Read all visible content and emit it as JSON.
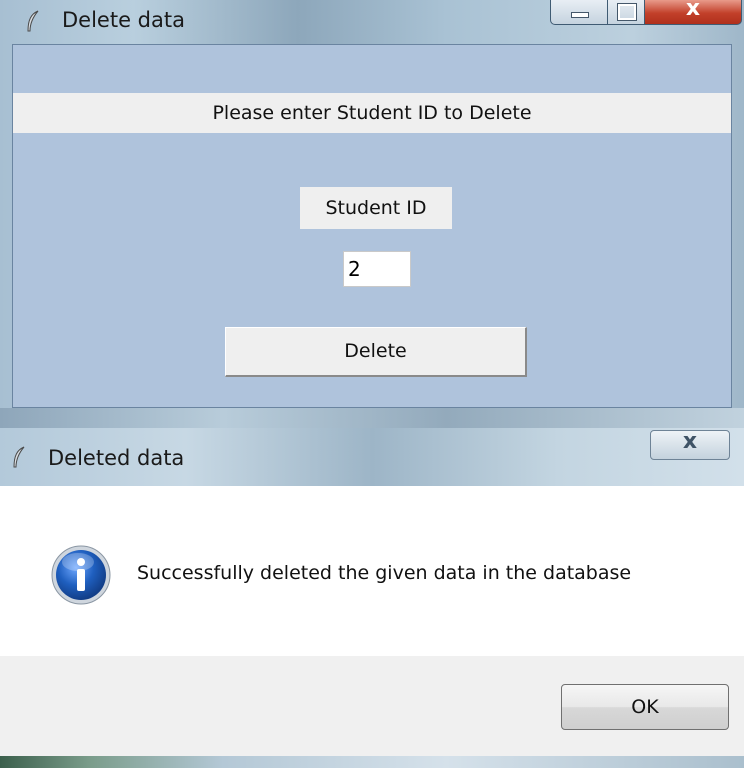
{
  "top_window": {
    "title": "Delete data",
    "banner": "Please enter Student ID to Delete",
    "field_label": "Student ID",
    "input_value": "2",
    "delete_label": "Delete"
  },
  "dialog": {
    "title": "Deleted data",
    "message": "Successfully deleted the given data in the database",
    "ok_label": "OK"
  },
  "icons": {
    "app": "feather-icon",
    "info": "info-icon",
    "close": "close-icon",
    "minimize": "minimize-icon",
    "maximize": "maximize-icon"
  },
  "colors": {
    "client_background": "#afc3dc",
    "label_background": "#efefef",
    "close_button_red": "#c2402a",
    "info_blue": "#1f5fbf"
  }
}
